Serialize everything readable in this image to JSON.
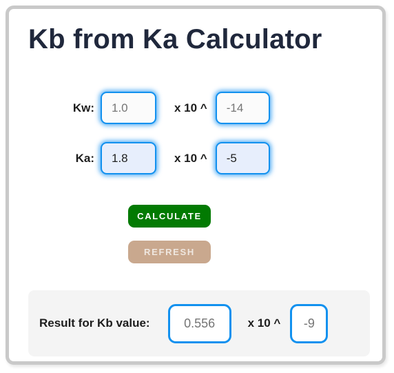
{
  "app": {
    "title": "Kb from Ka Calculator"
  },
  "colors": {
    "title_text": "#20283c",
    "input_border": "#1291ef",
    "input_glow": "#1991f0",
    "calculate_bg": "#027a02",
    "calculate_text": "#ffffff",
    "refresh_bg": "#c9a88e",
    "refresh_text": "#efe7e0",
    "panel_bg": "#f4f4f4",
    "card_border": "#c9c9c9",
    "filled_input_bg": "#e7eefc"
  },
  "form": {
    "rows": [
      {
        "label": "Kw:",
        "mantissa_value": "",
        "mantissa_placeholder": "1.0",
        "multiplier": "x 10 ^",
        "exponent_value": "",
        "exponent_placeholder": "-14"
      },
      {
        "label": "Ka:",
        "mantissa_value": "1.8",
        "mantissa_placeholder": "1.8",
        "multiplier": "x 10 ^",
        "exponent_value": "-5",
        "exponent_placeholder": "-5"
      }
    ]
  },
  "buttons": {
    "calculate_label": "Calculate",
    "refresh_label": "Refresh"
  },
  "result": {
    "label": "Result for Kb value:",
    "value": "",
    "value_placeholder": "0.556",
    "multiplier": "x 10 ^",
    "exponent": "",
    "exponent_placeholder": "-9"
  }
}
